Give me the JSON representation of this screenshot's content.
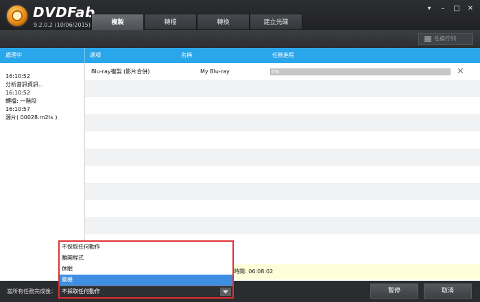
{
  "app": {
    "name": "DVDFab",
    "version": "9.2.0.2 (10/06/2015)"
  },
  "tabs": [
    {
      "label": "複製"
    },
    {
      "label": "轉檔"
    },
    {
      "label": "轉換"
    },
    {
      "label": "建立光碟"
    }
  ],
  "window": {
    "menu": "▾",
    "minimize": "–",
    "maximize": "□",
    "close": "✕"
  },
  "toolbar": {
    "queue_label": "任務佇列"
  },
  "columns": {
    "processing": "處理中",
    "option": "選項",
    "name": "名稱",
    "progress": "任務進程"
  },
  "log": [
    "16:10:52",
    "分析音訊資訊...",
    "16:10:52",
    "轉檔: 一階段",
    "16:10:57",
    "源片( 00028.m2ts )"
  ],
  "tasks": [
    {
      "option": "Blu-ray複製 (影片合併)",
      "name": "My Blu-ray",
      "progress_text": "0%",
      "progress": 0
    }
  ],
  "status": {
    "time_text": "時間: 06:08:02"
  },
  "bottom": {
    "after_label": "當所有任務完成後：",
    "pause": "暫停",
    "cancel": "取消"
  },
  "dropdown": {
    "options": [
      "不採取任何動作",
      "離開程式",
      "休眠",
      "關機"
    ],
    "highlighted_index": 3,
    "selected": "不採取任何動作"
  },
  "colors": {
    "accent": "#2aa6ea",
    "highlight": "#3e8fe2",
    "dropdown_border": "#e03030"
  }
}
